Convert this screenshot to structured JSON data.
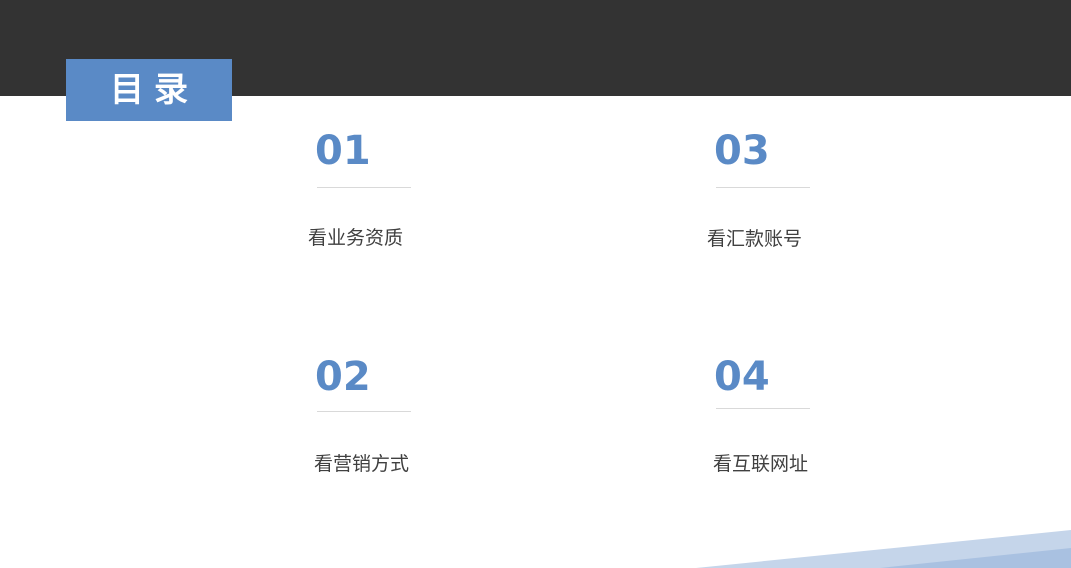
{
  "header": {
    "title": "目录"
  },
  "items": [
    {
      "number": "01",
      "label": "看业务资质"
    },
    {
      "number": "02",
      "label": "看营销方式"
    },
    {
      "number": "03",
      "label": "看汇款账号"
    },
    {
      "number": "04",
      "label": "看互联网址"
    }
  ],
  "colors": {
    "top_bar": "#333333",
    "accent": "#5a8ac6",
    "label_text": "#404040",
    "divider": "#d9d9d9",
    "decor_light": "#c5d5ea",
    "decor_mid": "#a9c1e1"
  }
}
